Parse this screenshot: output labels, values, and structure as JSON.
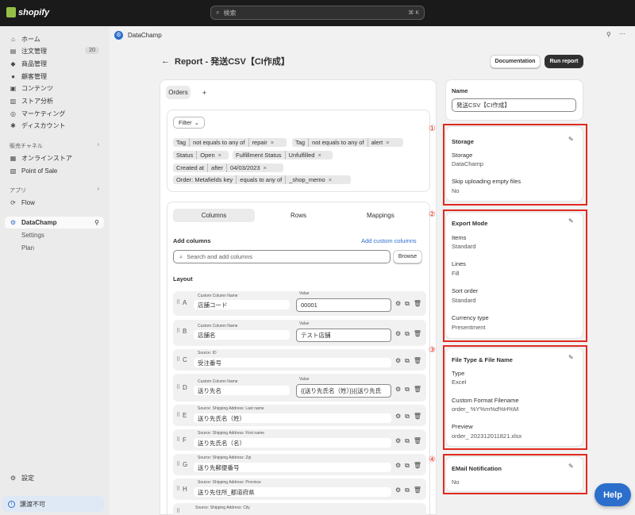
{
  "topbar": {
    "brand": "shopify",
    "search_placeholder": "検索",
    "shortcut": "⌘ K"
  },
  "sidebar": {
    "items": [
      {
        "label": "ホーム",
        "icon": "home-icon"
      },
      {
        "label": "注文管理",
        "icon": "orders-icon",
        "badge": "20"
      },
      {
        "label": "商品管理",
        "icon": "tag-icon"
      },
      {
        "label": "顧客管理",
        "icon": "person-icon"
      },
      {
        "label": "コンテンツ",
        "icon": "content-icon"
      },
      {
        "label": "ストア分析",
        "icon": "chart-icon"
      },
      {
        "label": "マーケティング",
        "icon": "target-icon"
      },
      {
        "label": "ディスカウント",
        "icon": "discount-icon"
      }
    ],
    "channels_header": "販売チャネル",
    "channels": [
      {
        "label": "オンラインストア",
        "icon": "store-icon"
      },
      {
        "label": "Point of Sale",
        "icon": "pos-icon"
      }
    ],
    "apps_header": "アプリ",
    "apps": [
      {
        "label": "Flow",
        "icon": "flow-icon"
      }
    ],
    "active_app": {
      "label": "DataChamp",
      "icon": "datachamp-icon"
    },
    "sub_items": [
      "Settings",
      "Plan"
    ],
    "settings": "設定",
    "notice": "譲渡不可"
  },
  "app_header": {
    "name": "DataChamp"
  },
  "page": {
    "title": "Report - 発送CSV【CI作成】",
    "documentation": "Documentation",
    "run": "Run report"
  },
  "report": {
    "tab": "Orders",
    "add_tab": "+",
    "filter_label": "Filter",
    "chips": [
      [
        "Tag",
        "not equals to any of",
        "repair"
      ],
      [
        "Tag",
        "not equals to any of",
        "alert"
      ],
      [
        "Status",
        "Open"
      ],
      [
        "Fulfillment Status",
        "Unfulfilled"
      ],
      [
        "Created at",
        "after",
        "04/03/2023"
      ],
      [
        "Order: Metafields key",
        "equals to any of",
        "_shop_memo"
      ]
    ],
    "subtabs": [
      "Columns",
      "Rows",
      "Mappings"
    ],
    "add_columns": "Add columns",
    "add_custom": "Add custom columns",
    "search_placeholder": "Search and add columns",
    "browse": "Browse",
    "layout": "Layout",
    "rows": [
      {
        "letter": "A",
        "label": "Custom Column Name",
        "name": "店舗コード",
        "value_label": "Value",
        "value": "00001"
      },
      {
        "letter": "B",
        "label": "Custom Column Name",
        "name": "店舗名",
        "value_label": "Value",
        "value": "テスト店舗"
      },
      {
        "letter": "C",
        "label": "Source: ID",
        "name": "受注番号"
      },
      {
        "letter": "D",
        "label": "Custom Column Name",
        "name": "送り先名",
        "value_label": "Value",
        "value": "{{送り先氏名（姓）}}{{送り先氏"
      },
      {
        "letter": "E",
        "label": "Source: Shipping Address: Last name",
        "name": "送り先氏名（姓）"
      },
      {
        "letter": "F",
        "label": "Source: Shipping Address: First name",
        "name": "送り先氏名（名）"
      },
      {
        "letter": "G",
        "label": "Source: Shipping Address: Zip",
        "name": "送り先郵便番号"
      },
      {
        "letter": "H",
        "label": "Source: Shipping Address: Province",
        "name": "送り先住所_都道府県"
      },
      {
        "letter": "I",
        "label": "Source: Shipping Address: City",
        "name": ""
      }
    ]
  },
  "right": {
    "name_label": "Name",
    "name_value": "発送CSV【CI作成】",
    "storage": {
      "num": "①",
      "title": "Storage",
      "fields": [
        [
          "Storage",
          "DataChamp"
        ],
        [
          "Skip uploading empty files",
          "No"
        ]
      ]
    },
    "export": {
      "num": "②",
      "title": "Export Mode",
      "fields": [
        [
          "Items",
          "Standard"
        ],
        [
          "Lines",
          "Fill"
        ],
        [
          "Sort order",
          "Standard"
        ],
        [
          "Currency type",
          "Presentment"
        ]
      ]
    },
    "filetype": {
      "num": "③",
      "title": "File Type & File Name",
      "fields": [
        [
          "Type",
          "Excel"
        ],
        [
          "Custom Format Filename",
          "order_ %Y%m%d%H%M"
        ],
        [
          "Preview",
          "order_ 202312011821.xlsx"
        ]
      ]
    },
    "email": {
      "num": "④",
      "title": "EMail Notification",
      "fields": [
        [
          "No",
          ""
        ]
      ]
    }
  },
  "help": "Help",
  "colors": {
    "accent": "#2c6ecb",
    "annotation": "#e02a20",
    "topbar": "#1a1a1a"
  }
}
